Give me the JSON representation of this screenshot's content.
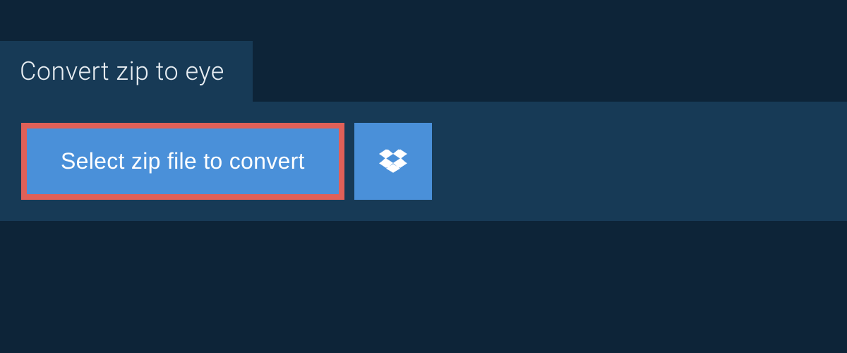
{
  "tab": {
    "title": "Convert zip to eye"
  },
  "actions": {
    "select_label": "Select zip file to convert",
    "dropbox_icon": "dropbox-icon"
  },
  "colors": {
    "background": "#0d2438",
    "panel": "#173a56",
    "button": "#4a90d9",
    "highlight_border": "#e06058",
    "text_light": "#e8eef3",
    "text_white": "#ffffff"
  }
}
